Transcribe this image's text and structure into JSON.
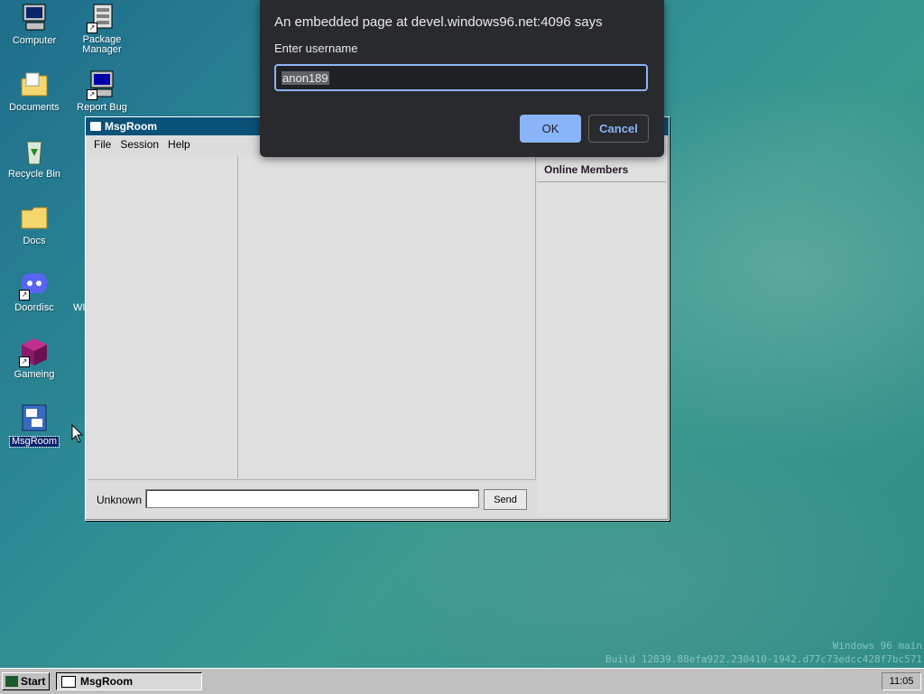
{
  "desktop": {
    "icons": [
      {
        "label": "Computer"
      },
      {
        "label": "Package Manager"
      },
      {
        "label": "Documents"
      },
      {
        "label": "Report Bug"
      },
      {
        "label": "Recycle Bin"
      },
      {
        "label": "Docs"
      },
      {
        "label": "Doordisc"
      },
      {
        "label": "Gameing"
      },
      {
        "label": "MsgRoom"
      }
    ],
    "partial_label": "WI"
  },
  "window": {
    "title": "MsgRoom",
    "menu": [
      "File",
      "Session",
      "Help"
    ],
    "members_heading": "Online Members",
    "sender_label": "Unknown",
    "message_placeholder": "",
    "send_label": "Send"
  },
  "dialog": {
    "title": "An embedded page at devel.windows96.net:4096 says",
    "prompt": "Enter username",
    "input_value": "anon189",
    "ok_label": "OK",
    "cancel_label": "Cancel"
  },
  "watermark": {
    "line1": "Windows 96 main",
    "line2": "Build 12839.88efa922.230410-1942.d77c73edcc428f7bc571"
  },
  "taskbar": {
    "start_label": "Start",
    "task_label": "MsgRoom",
    "clock": "11:05"
  }
}
